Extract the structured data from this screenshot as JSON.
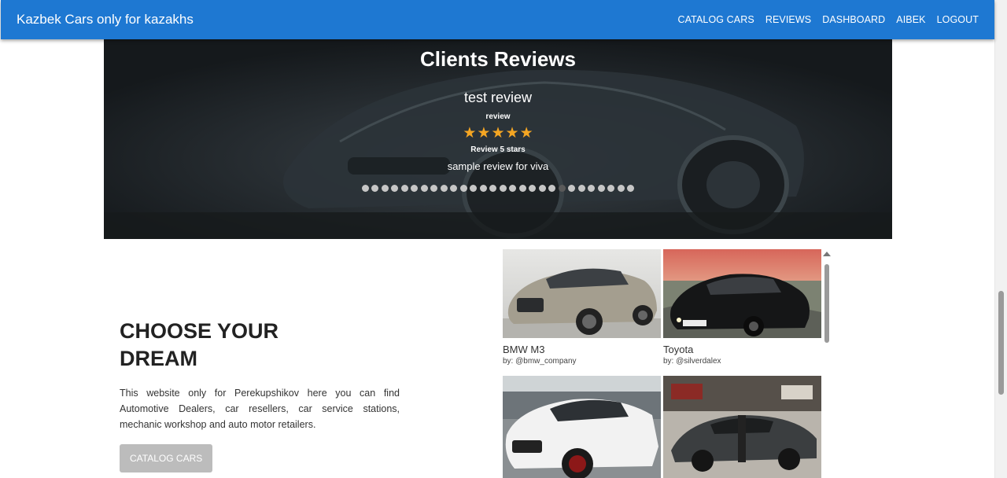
{
  "navbar": {
    "brand": "Kazbek Cars only for kazakhs",
    "links": [
      "CATALOG CARS",
      "REVIEWS",
      "DASHBOARD",
      "AIBEK",
      "LOGOUT"
    ],
    "color": "#1e78d2"
  },
  "reviews": {
    "heading": "Clients Reviews",
    "current": {
      "title": "test review",
      "subtitle": "review",
      "stars": 5,
      "rating_text": "Review 5 stars",
      "text": "sample review for viva"
    },
    "dot_count": 28,
    "active_dot": 20,
    "star_color": "#f5a623"
  },
  "hero": {
    "title_line1": "CHOOSE YOUR",
    "title_line2": "DREAM",
    "description": "This website only for Perekupshikov here you can find Automotive Dealers, car resellers, car service stations, mechanic workshop and auto motor retailers.",
    "button_label": "CATALOG CARS"
  },
  "gallery": {
    "items": [
      {
        "name": "BMW M3",
        "author": "by: @bmw_company"
      },
      {
        "name": "Toyota",
        "author": "by: @silverdalex"
      },
      {
        "name": "",
        "author": ""
      },
      {
        "name": "",
        "author": ""
      }
    ]
  }
}
